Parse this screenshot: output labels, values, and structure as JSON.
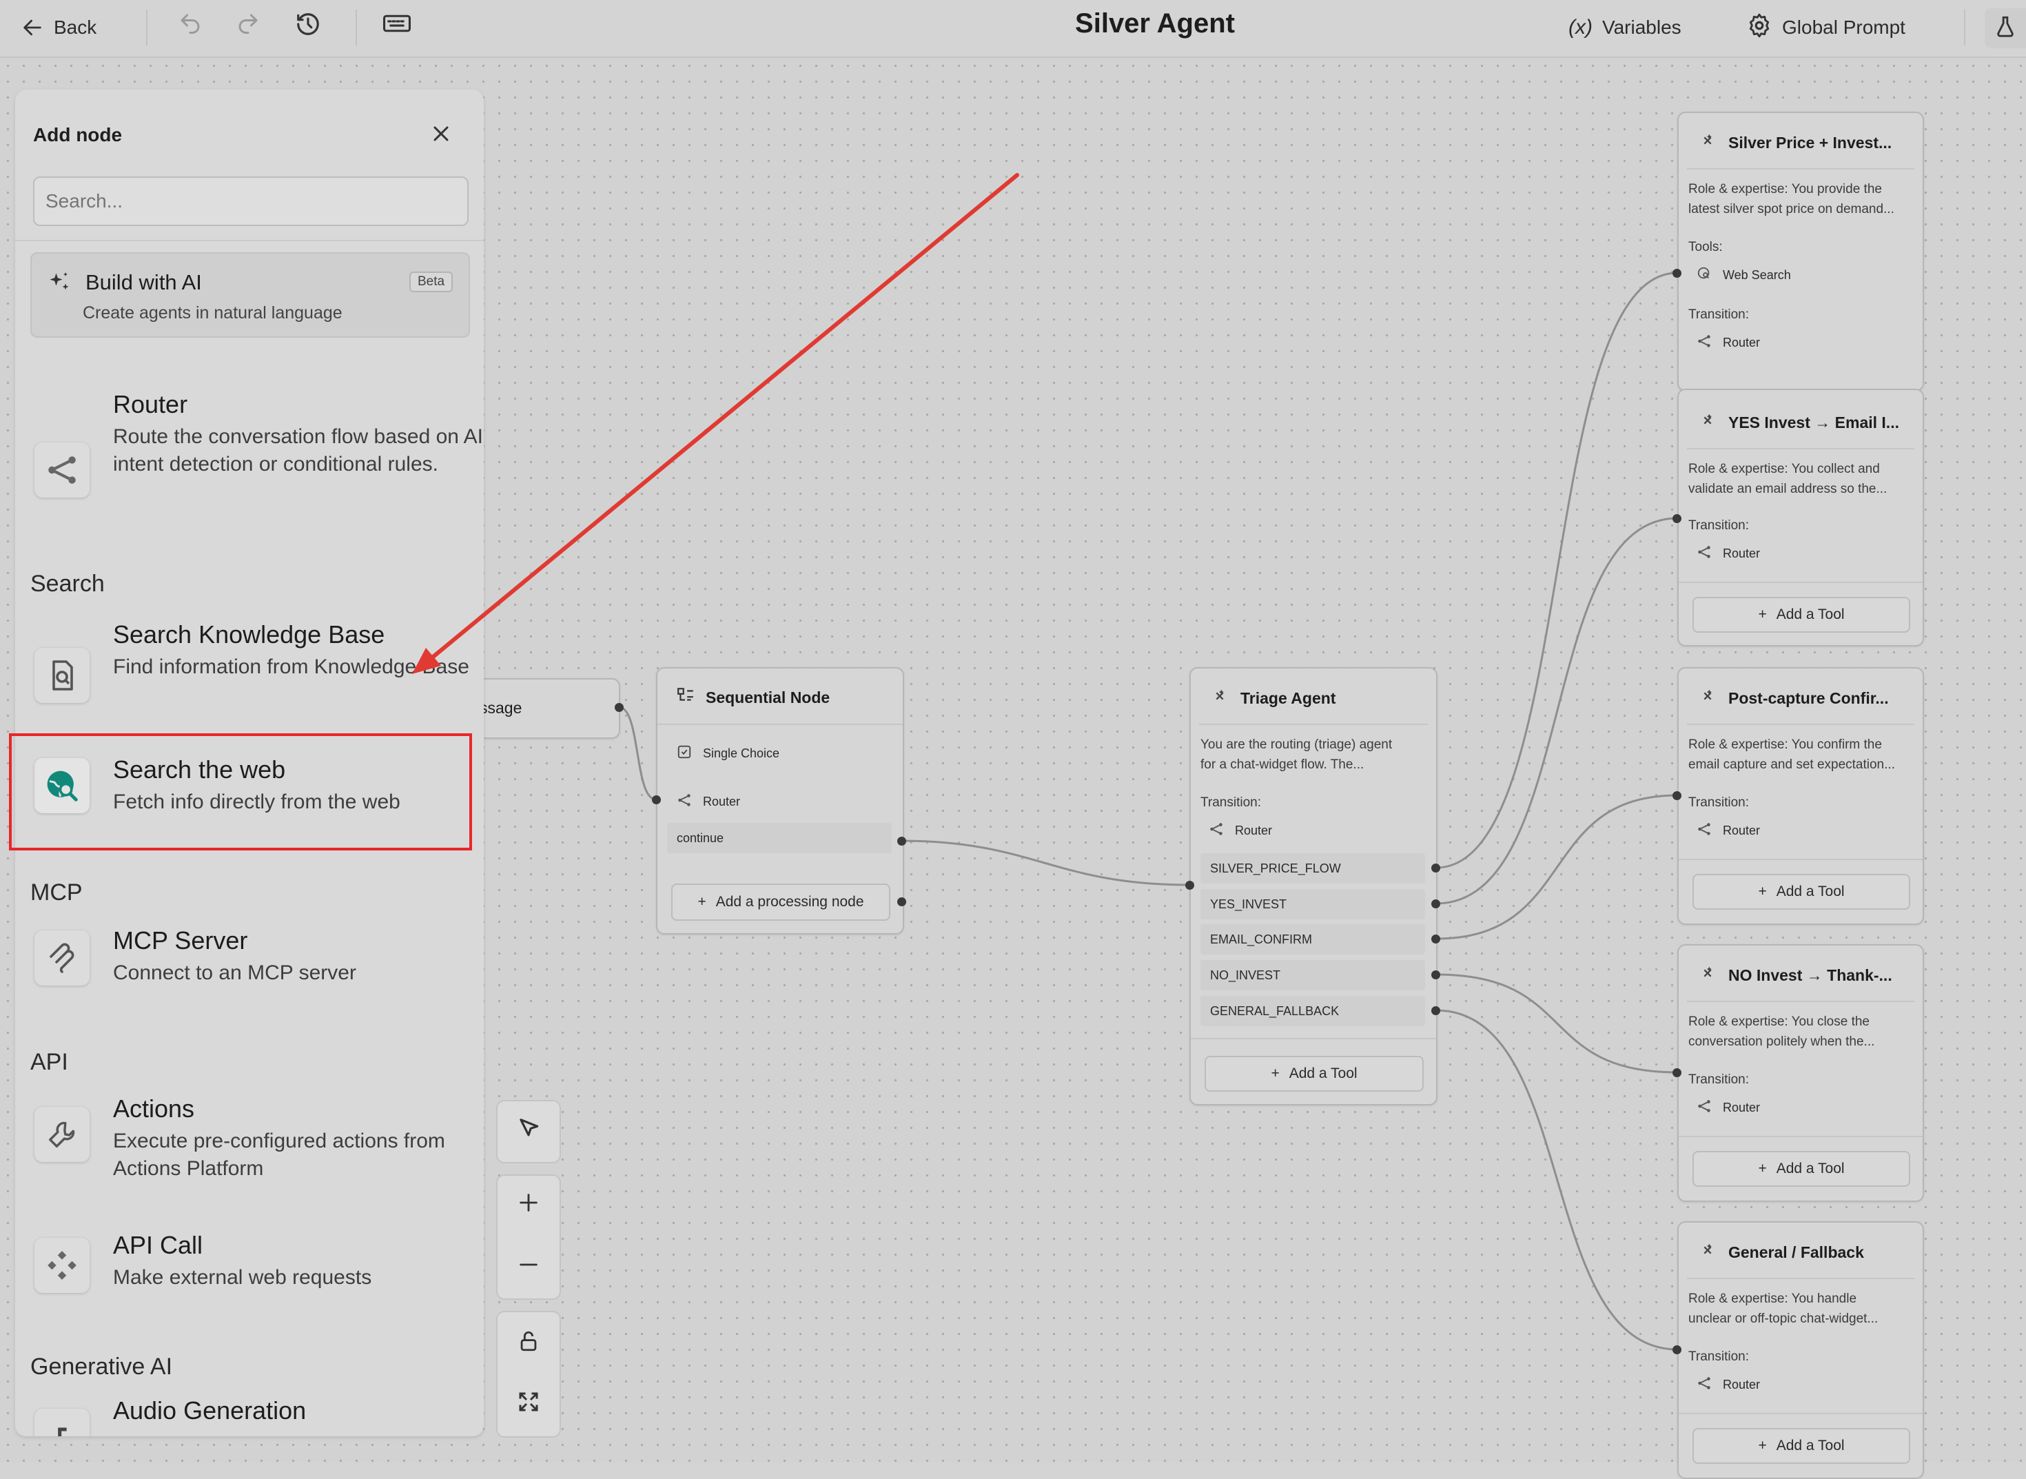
{
  "topbar": {
    "back_label": "Back",
    "title": "Silver Agent",
    "variables_label": "Variables",
    "variables_icon_text": "(x)",
    "global_prompt_label": "Global Prompt"
  },
  "panel": {
    "title": "Add node",
    "search_placeholder": "Search...",
    "build_ai": {
      "title": "Build with AI",
      "subtitle": "Create agents in natural language",
      "badge": "Beta"
    },
    "router": {
      "title": "Router",
      "desc": "Route the conversation flow based on AI intent detection or conditional rules."
    },
    "sections": {
      "search": "Search",
      "mcp": "MCP",
      "api": "API",
      "generative": "Generative AI"
    },
    "search_kb": {
      "title": "Search Knowledge Base",
      "desc": "Find information from Knowledge Base"
    },
    "search_web": {
      "title": "Search the web",
      "desc": "Fetch info directly from the web"
    },
    "mcp_server": {
      "title": "MCP Server",
      "desc": "Connect to an MCP server"
    },
    "actions": {
      "title": "Actions",
      "desc": "Execute pre-configured actions from Actions Platform"
    },
    "api_call": {
      "title": "API Call",
      "desc": "Make external web requests"
    },
    "audio": {
      "title": "Audio Generation"
    }
  },
  "partial_node_label": "ssage",
  "sequential": {
    "title": "Sequential Node",
    "single_choice": "Single Choice",
    "router": "Router",
    "continue": "continue",
    "add_label": "Add a processing node"
  },
  "triage": {
    "title": "Triage Agent",
    "desc_line1": "You are the routing (triage) agent",
    "desc_line2": "for a chat-widget flow. The...",
    "transition_label": "Transition:",
    "router": "Router",
    "options": [
      "SILVER_PRICE_FLOW",
      "YES_INVEST",
      "EMAIL_CONFIRM",
      "NO_INVEST",
      "GENERAL_FALLBACK"
    ],
    "add_tool": "Add a Tool"
  },
  "agents": [
    {
      "title": "Silver Price + Invest...",
      "desc1": "Role & expertise: You provide the",
      "desc2": "latest silver spot price on demand...",
      "tools_label": "Tools:",
      "tool": "Web Search",
      "transition_label": "Transition:",
      "router": "Router"
    },
    {
      "title": "YES Invest → Email I...",
      "desc1": "Role & expertise: You collect and",
      "desc2": "validate an email address so the...",
      "transition_label": "Transition:",
      "router": "Router",
      "add_tool": "Add a Tool"
    },
    {
      "title": "Post-capture Confir...",
      "desc1": "Role & expertise: You confirm the",
      "desc2": "email capture and set expectation...",
      "transition_label": "Transition:",
      "router": "Router",
      "add_tool": "Add a Tool"
    },
    {
      "title": "NO Invest → Thank-...",
      "desc1": "Role & expertise: You close the",
      "desc2": "conversation politely when the...",
      "transition_label": "Transition:",
      "router": "Router",
      "add_tool": "Add a Tool"
    },
    {
      "title": "General / Fallback",
      "desc1": "Role & expertise: You handle",
      "desc2": "unclear or off-topic chat-widget...",
      "transition_label": "Transition:",
      "router": "Router",
      "add_tool": "Add a Tool"
    }
  ],
  "colors": {
    "highlight_box": "#e8262a",
    "arrow": "#e03a32",
    "web_icon": "#11897a"
  }
}
